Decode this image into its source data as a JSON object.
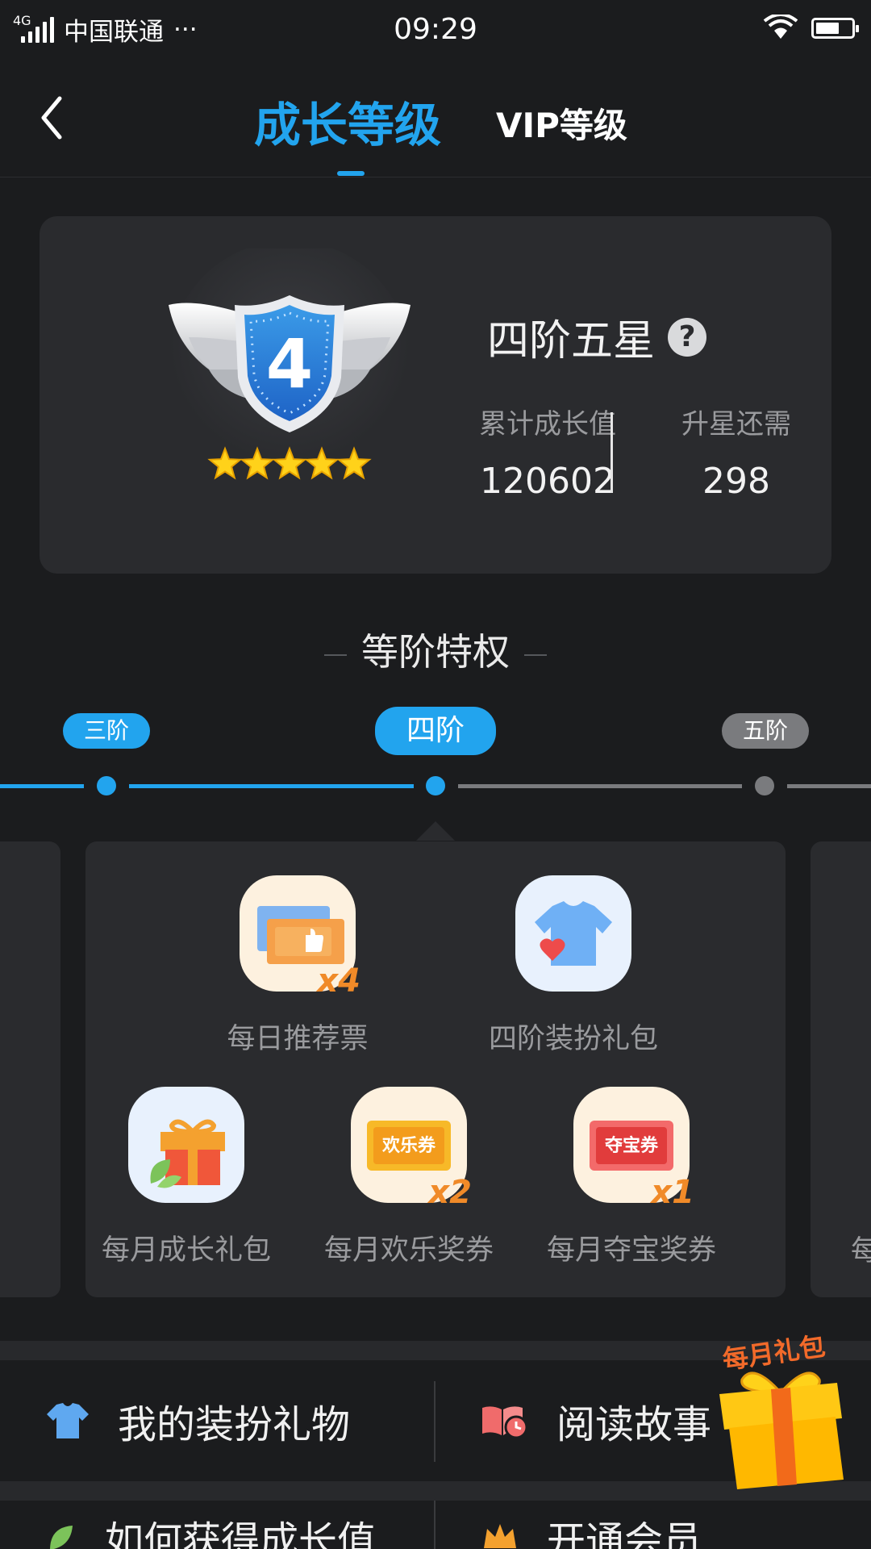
{
  "status_bar": {
    "network": "4G",
    "carrier": "中国联通",
    "more": "···",
    "time": "09:29"
  },
  "nav": {
    "back_icon": "chevron-left-icon",
    "tab_active": "成长等级",
    "tab_inactive": "VIP等级"
  },
  "level_card": {
    "badge_number": "4",
    "stars_filled": 5,
    "stars_total": 5,
    "title": "四阶五星",
    "help": "?",
    "stat1_label": "累计成长值",
    "stat1_value": "120602",
    "stat2_label": "升星还需",
    "stat2_value": "298"
  },
  "section_title": "等阶特权",
  "stages": {
    "prev": "三阶",
    "current": "四阶",
    "next": "五阶"
  },
  "benefits": [
    {
      "label": "每日推荐票",
      "multiplier": "x4",
      "icon": "ticket-thumb-icon"
    },
    {
      "label": "四阶装扮礼包",
      "multiplier": "",
      "icon": "tshirt-heart-icon"
    },
    {
      "label": "每月成长礼包",
      "multiplier": "",
      "icon": "gift-leaf-icon"
    },
    {
      "label": "每月欢乐奖券",
      "multiplier": "x2",
      "icon": "ticket-icon",
      "ticket_text": "欢乐券"
    },
    {
      "label": "每月夺宝奖券",
      "multiplier": "x1",
      "icon": "ticket-icon",
      "ticket_text": "夺宝券"
    }
  ],
  "right_peek_label": "每",
  "links": {
    "row1_left": "我的装扮礼物",
    "row1_right": "阅读故事",
    "row2_left": "如何获得成长值",
    "row2_right": "开通会员"
  },
  "monthly_gift": "每月礼包",
  "colors": {
    "accent": "#22a4ee",
    "background": "#1b1c1e",
    "card": "#2a2b2e",
    "orange": "#f08a28"
  }
}
